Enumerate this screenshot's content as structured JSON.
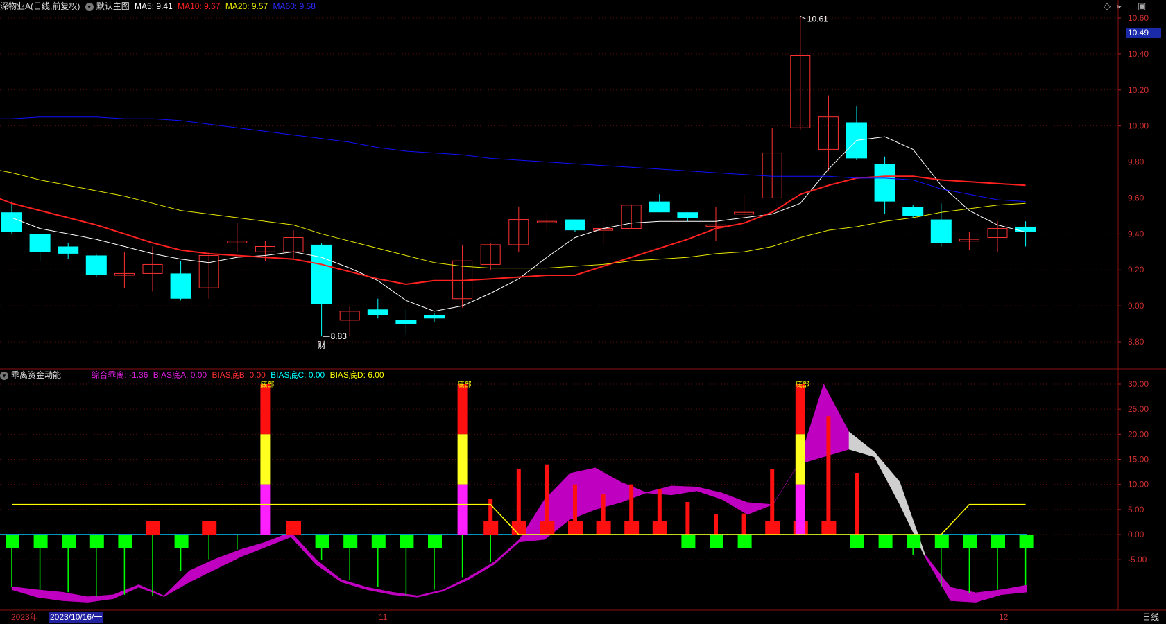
{
  "main_header": {
    "title": "深物业A(日线,前复权)",
    "template": "默认主图",
    "ma5": "MA5: 9.41",
    "ma10": "MA10: 9.67",
    "ma20": "MA20: 9.57",
    "ma60": "MA60: 9.58"
  },
  "sub_header": {
    "title": "乖离资金动能",
    "line1": "综合乖离: -1.36",
    "line2": "BIAS底A: 0.00",
    "line3": "BIAS底B: 0.00",
    "line4": "BIAS底C: 0.00",
    "line5": "BIAS底D: 6.00"
  },
  "current_price": "10.49",
  "markers": {
    "high": "10.61",
    "low": "8.83",
    "finance": "财",
    "signal": "底部"
  },
  "xaxis": {
    "year": "2023年",
    "cursor_date": "2023/10/16/一",
    "nov": "11",
    "dec": "12"
  },
  "period_label": "日线",
  "colors": {
    "up": "#ff3232",
    "down": "#00ffff",
    "ma5": "#ffffff",
    "ma10": "#ff2020",
    "ma20": "#e8e800",
    "ma60": "#1010ff"
  },
  "chart_data": [
    {
      "type": "candlestick",
      "title": "深物业A(日线,前复权)",
      "ylim": [
        8.75,
        10.65
      ],
      "yticks": [
        8.8,
        9.0,
        9.2,
        9.4,
        9.6,
        9.8,
        10.0,
        10.2,
        10.4,
        10.6
      ],
      "candles": [
        {
          "o": 9.52,
          "h": 9.58,
          "l": 9.4,
          "c": 9.41
        },
        {
          "o": 9.4,
          "h": 9.4,
          "l": 9.25,
          "c": 9.3
        },
        {
          "o": 9.33,
          "h": 9.35,
          "l": 9.26,
          "c": 9.29
        },
        {
          "o": 9.28,
          "h": 9.29,
          "l": 9.16,
          "c": 9.17
        },
        {
          "o": 9.17,
          "h": 9.3,
          "l": 9.1,
          "c": 9.18
        },
        {
          "o": 9.18,
          "h": 9.33,
          "l": 9.08,
          "c": 9.23
        },
        {
          "o": 9.18,
          "h": 9.25,
          "l": 9.03,
          "c": 9.04
        },
        {
          "o": 9.1,
          "h": 9.3,
          "l": 9.04,
          "c": 9.28
        },
        {
          "o": 9.35,
          "h": 9.46,
          "l": 9.3,
          "c": 9.36
        },
        {
          "o": 9.3,
          "h": 9.36,
          "l": 9.25,
          "c": 9.33
        },
        {
          "o": 9.3,
          "h": 9.42,
          "l": 9.26,
          "c": 9.38
        },
        {
          "o": 9.34,
          "h": 9.35,
          "l": 8.83,
          "c": 9.01
        },
        {
          "o": 8.92,
          "h": 9.0,
          "l": 8.83,
          "c": 8.97
        },
        {
          "o": 8.98,
          "h": 9.04,
          "l": 8.93,
          "c": 8.95
        },
        {
          "o": 8.92,
          "h": 8.98,
          "l": 8.84,
          "c": 8.9
        },
        {
          "o": 8.95,
          "h": 8.96,
          "l": 8.91,
          "c": 8.93
        },
        {
          "o": 9.04,
          "h": 9.34,
          "l": 8.99,
          "c": 9.25
        },
        {
          "o": 9.23,
          "h": 9.35,
          "l": 9.2,
          "c": 9.34
        },
        {
          "o": 9.34,
          "h": 9.55,
          "l": 9.3,
          "c": 9.48
        },
        {
          "o": 9.47,
          "h": 9.51,
          "l": 9.42,
          "c": 9.47
        },
        {
          "o": 9.48,
          "h": 9.48,
          "l": 9.41,
          "c": 9.42
        },
        {
          "o": 9.42,
          "h": 9.48,
          "l": 9.34,
          "c": 9.43
        },
        {
          "o": 9.43,
          "h": 9.56,
          "l": 9.43,
          "c": 9.56
        },
        {
          "o": 9.58,
          "h": 9.62,
          "l": 9.52,
          "c": 9.52
        },
        {
          "o": 9.52,
          "h": 9.52,
          "l": 9.47,
          "c": 9.49
        },
        {
          "o": 9.45,
          "h": 9.55,
          "l": 9.36,
          "c": 9.45
        },
        {
          "o": 9.51,
          "h": 9.62,
          "l": 9.48,
          "c": 9.52
        },
        {
          "o": 9.6,
          "h": 9.99,
          "l": 9.6,
          "c": 9.85
        },
        {
          "o": 9.99,
          "h": 10.61,
          "l": 9.98,
          "c": 10.39
        },
        {
          "o": 9.87,
          "h": 10.17,
          "l": 9.75,
          "c": 10.05
        },
        {
          "o": 10.02,
          "h": 10.11,
          "l": 9.81,
          "c": 9.82
        },
        {
          "o": 9.79,
          "h": 9.83,
          "l": 9.51,
          "c": 9.58
        },
        {
          "o": 9.55,
          "h": 9.56,
          "l": 9.49,
          "c": 9.5
        },
        {
          "o": 9.48,
          "h": 9.57,
          "l": 9.33,
          "c": 9.35
        },
        {
          "o": 9.36,
          "h": 9.41,
          "l": 9.31,
          "c": 9.37
        },
        {
          "o": 9.38,
          "h": 9.47,
          "l": 9.3,
          "c": 9.43
        },
        {
          "o": 9.44,
          "h": 9.47,
          "l": 9.33,
          "c": 9.41
        }
      ],
      "series": [
        {
          "name": "MA5",
          "values": [
            9.49,
            9.43,
            9.4,
            9.37,
            9.33,
            9.29,
            9.26,
            9.24,
            9.27,
            9.28,
            9.3,
            9.27,
            9.21,
            9.14,
            9.03,
            8.97,
            9.0,
            9.07,
            9.15,
            9.27,
            9.38,
            9.43,
            9.46,
            9.47,
            9.47,
            9.47,
            9.49,
            9.51,
            9.57,
            9.76,
            9.92,
            9.94,
            9.87,
            9.67,
            9.53,
            9.45,
            9.41
          ]
        },
        {
          "name": "MA10",
          "values": [
            9.63,
            9.57,
            9.53,
            9.49,
            9.45,
            9.4,
            9.35,
            9.31,
            9.29,
            9.28,
            9.27,
            9.26,
            9.23,
            9.19,
            9.15,
            9.12,
            9.14,
            9.14,
            9.15,
            9.16,
            9.17,
            9.17,
            9.22,
            9.27,
            9.32,
            9.37,
            9.43,
            9.46,
            9.52,
            9.62,
            9.67,
            9.71,
            9.72,
            9.72,
            9.7,
            9.69,
            9.68,
            9.67
          ]
        },
        {
          "name": "MA20",
          "values": [
            9.77,
            9.74,
            9.7,
            9.67,
            9.64,
            9.61,
            9.57,
            9.53,
            9.51,
            9.49,
            9.47,
            9.45,
            9.4,
            9.36,
            9.32,
            9.28,
            9.24,
            9.22,
            9.21,
            9.21,
            9.21,
            9.22,
            9.23,
            9.25,
            9.26,
            9.27,
            9.29,
            9.3,
            9.33,
            9.38,
            9.42,
            9.44,
            9.47,
            9.49,
            9.52,
            9.54,
            9.56,
            9.57
          ]
        },
        {
          "name": "MA60",
          "values": [
            10.04,
            10.04,
            10.04,
            10.05,
            10.05,
            10.05,
            10.04,
            10.04,
            10.03,
            10.01,
            9.99,
            9.97,
            9.95,
            9.93,
            9.91,
            9.88,
            9.86,
            9.85,
            9.84,
            9.82,
            9.81,
            9.8,
            9.79,
            9.78,
            9.77,
            9.76,
            9.75,
            9.74,
            9.73,
            9.72,
            9.72,
            9.72,
            9.71,
            9.71,
            9.7,
            9.65,
            9.62,
            9.59,
            9.58
          ]
        }
      ]
    },
    {
      "type": "bar",
      "title": "乖离资金动能",
      "ylim": [
        -13.5,
        30.5
      ],
      "yticks": [
        -5,
        0,
        5,
        10,
        15,
        20,
        25,
        30
      ],
      "band_upper": [
        -10.4,
        -11.0,
        -11.5,
        -12.4,
        -12.0,
        -10.0,
        -12.2,
        -7.2,
        -4.9,
        -3.0,
        -1.5,
        0.5,
        -5.0,
        -9.0,
        -10.5,
        -11.5,
        -12.2,
        -11.0,
        -8.5,
        -5.5,
        -1.0,
        7.0,
        12.2,
        13.3,
        10.5,
        8.4,
        9.7,
        9.5,
        8.3,
        6.4,
        6.0,
        14.0,
        30.0,
        17.0,
        15.5,
        6.0,
        -4.0,
        -10.5,
        -11.6,
        -11.0,
        -10.1
      ],
      "band_lower": [
        -11.0,
        -12.5,
        -13.2,
        -13.5,
        -12.8,
        -10.5,
        -12.4,
        -9.5,
        -7.0,
        -4.5,
        -2.5,
        -0.5,
        -6.0,
        -9.5,
        -11.0,
        -12.0,
        -12.5,
        -11.3,
        -9.0,
        -6.0,
        -1.5,
        -1.0,
        3.0,
        5.0,
        6.4,
        8.3,
        7.9,
        8.7,
        7.0,
        4.0,
        6.0,
        14.0,
        15.5,
        20.5,
        16.5,
        10.5,
        -4.5,
        -13.2,
        -13.5,
        -12.0,
        -11.5
      ],
      "red_bars": [
        0,
        0,
        0,
        0,
        0,
        0,
        0,
        0,
        0,
        30,
        0,
        0,
        0,
        0,
        0,
        0,
        30,
        7.2,
        13,
        14,
        10,
        8,
        10,
        9,
        6.5,
        4,
        4.2,
        13.1,
        30,
        23.6,
        12.3,
        0,
        0,
        0,
        0,
        0,
        0
      ],
      "yellow_line": [
        6,
        6,
        6,
        6,
        6,
        6,
        6,
        6,
        6,
        6,
        6,
        6,
        6,
        6,
        6,
        6,
        6,
        6,
        0,
        0,
        0,
        0,
        0,
        0,
        0,
        0,
        0,
        0,
        0,
        0,
        0,
        0,
        0,
        0,
        6,
        6,
        6
      ]
    }
  ]
}
